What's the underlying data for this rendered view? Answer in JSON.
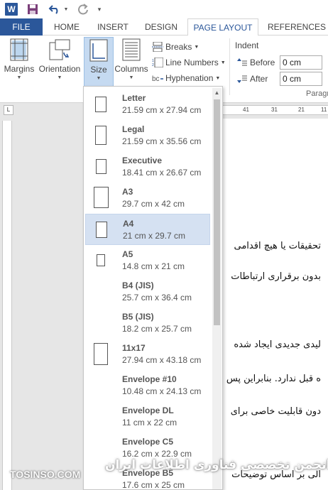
{
  "qat": {
    "app_icon": "W",
    "save_icon": "save-icon",
    "undo_icon": "undo-icon",
    "redo_icon": "redo-icon"
  },
  "tabs": [
    {
      "label": "FILE"
    },
    {
      "label": "HOME"
    },
    {
      "label": "INSERT"
    },
    {
      "label": "DESIGN"
    },
    {
      "label": "PAGE LAYOUT"
    },
    {
      "label": "REFERENCES"
    }
  ],
  "ribbon": {
    "margins": "Margins",
    "orientation": "Orientation",
    "size": "Size",
    "columns": "Columns",
    "breaks": "Breaks",
    "line_numbers": "Line Numbers",
    "hyphenation": "Hyphenation",
    "indent": "Indent",
    "before": "Before",
    "after": "After",
    "before_value": "0 cm",
    "after_value": "0 cm",
    "paragraph_group": "Paragr"
  },
  "ruler": {
    "corner": "L",
    "ticks": [
      "41",
      "31",
      "21",
      "11"
    ]
  },
  "size_menu": {
    "items": [
      {
        "name": "Letter",
        "dims": "21.59 cm x 27.94 cm"
      },
      {
        "name": "Legal",
        "dims": "21.59 cm x 35.56 cm"
      },
      {
        "name": "Executive",
        "dims": "18.41 cm x 26.67 cm"
      },
      {
        "name": "A3",
        "dims": "29.7 cm x 42 cm"
      },
      {
        "name": "A4",
        "dims": "21 cm x 29.7 cm"
      },
      {
        "name": "A5",
        "dims": "14.8 cm x 21 cm"
      },
      {
        "name": "B4 (JIS)",
        "dims": "25.7 cm x 36.4 cm"
      },
      {
        "name": "B5 (JIS)",
        "dims": "18.2 cm x 25.7 cm"
      },
      {
        "name": "11x17",
        "dims": "27.94 cm x 43.18 cm"
      },
      {
        "name": "Envelope #10",
        "dims": "10.48 cm x 24.13 cm"
      },
      {
        "name": "Envelope DL",
        "dims": "11 cm x 22 cm"
      },
      {
        "name": "Envelope C5",
        "dims": "16.2 cm x 22.9 cm"
      },
      {
        "name": "Envelope B5",
        "dims": "17.6 cm x 25 cm"
      }
    ],
    "selected": "A4"
  },
  "document": {
    "lines": [
      "تحقیقات یا هیچ اقدامی",
      "بدون برقراری ارتباطات",
      "لیدی جدیدی ایجاد شده",
      "ه قبل ندارد. بنابراین پس",
      "دون قابلیت خاصی برای",
      "الی بر اساس توضیحات"
    ]
  },
  "watermark": {
    "persian": "ITPro.ir - انجمن تخصصی فناوری اطلاعات ایران",
    "english": "TOSINSO.COM"
  }
}
